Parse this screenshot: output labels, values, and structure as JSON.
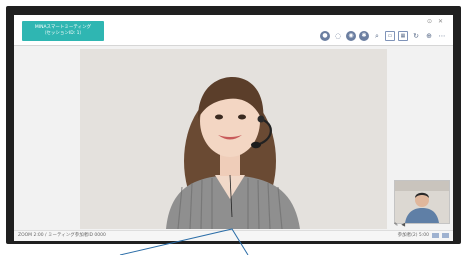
{
  "app": {
    "logo_line1": "MINAスマートミーティング",
    "logo_line2": "（セッションID: 1）"
  },
  "window_controls": "⊙ ✕",
  "toolbar_icons": [
    "user-icon",
    "chat-icon",
    "record-icon",
    "settings-icon",
    "search-icon",
    "share-screen-icon",
    "layout-icon",
    "refresh-icon",
    "zoom-icon",
    "more-icon"
  ],
  "footer": {
    "left_text": "ZOOM 2:00 / ミーティング参加者ID 0000",
    "right_text": "参加者(2) 5:00"
  },
  "pip_controls": [
    "✎",
    "◀"
  ],
  "colors": {
    "brand": "#2fb6b2",
    "frame": "#202020",
    "toolbar_icon": "#6b7ea0"
  }
}
